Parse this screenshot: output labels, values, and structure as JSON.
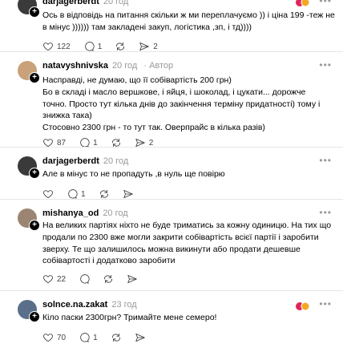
{
  "posts": [
    {
      "username": "darjagerberdt",
      "time": "20 год",
      "author_tag": "",
      "lines": [
        "Ось в відповідь на питання скільки ж ми переплачуємо )) і ціна 199 -теж не",
        "в мінус )))))) там закладені закуп, логістика ,зп, і тд))))"
      ],
      "likes": "122",
      "replies": "1",
      "reposts": "",
      "shares": "2",
      "has_reactions": true
    },
    {
      "username": "natavyshnivska",
      "time": "20 год",
      "author_tag": "Автор",
      "lines": [
        "Насправді, не думаю, що її собівартість 200 грн)",
        "Бо в складі і масло вершкове, і яйця, і шоколад, і цукати... дорожче",
        "точно. Просто тут кілька днів до закінчення терміну придатності) тому і",
        "знижка така)",
        "Стосовно 2300 грн - то тут так. Оверпрайс в кілька разів)"
      ],
      "likes": "87",
      "replies": "1",
      "reposts": "",
      "shares": "2",
      "has_reactions": false
    },
    {
      "username": "darjagerberdt",
      "time": "20 год",
      "author_tag": "",
      "lines": [
        "Але в мінус то не пропадуть ,в нуль ще повірю"
      ],
      "likes": "",
      "replies": "1",
      "reposts": "",
      "shares": "",
      "has_reactions": false
    },
    {
      "username": "mishanya_od",
      "time": "20 год",
      "author_tag": "",
      "lines": [
        "На великих партіях ніхто не буде триматись за кожну одиницю. На тих що",
        "продали по 2300 вже могли закрити собівартість всієї партії і заробити",
        "зверху. Те що залишилось можна викинути або продати дешевше",
        "собівартості і додатково заробити"
      ],
      "likes": "22",
      "replies": "",
      "reposts": "",
      "shares": "",
      "has_reactions": false
    },
    {
      "username": "solnce.na.zakat",
      "time": "23 год",
      "author_tag": "",
      "lines": [
        "Кіло паски 2300грн? Тримайте мене семеро!"
      ],
      "likes": "70",
      "replies": "1",
      "reposts": "",
      "shares": "",
      "has_reactions": true
    }
  ],
  "colors": {
    "text": "#000000",
    "muted": "#999999",
    "divider": "#e6e6e6",
    "heart_reaction": "#e0245e",
    "fire_reaction": "#f5a623"
  },
  "icons": [
    "heart-icon",
    "comment-icon",
    "repost-icon",
    "share-icon",
    "more-icon",
    "plus-icon",
    "avatar"
  ]
}
